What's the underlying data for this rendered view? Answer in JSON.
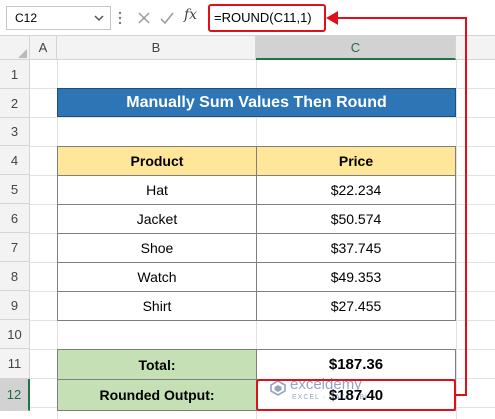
{
  "formula_bar": {
    "name_box": "C12",
    "fx_label": "fx",
    "formula": "=ROUND(C11,1)"
  },
  "columns": [
    "A",
    "B",
    "C"
  ],
  "rows": [
    "1",
    "2",
    "3",
    "4",
    "5",
    "6",
    "7",
    "8",
    "9",
    "10",
    "11",
    "12"
  ],
  "sheet": {
    "title": "Manually Sum Values Then Round",
    "table": {
      "headers": [
        "Product",
        "Price"
      ],
      "rows": [
        {
          "product": "Hat",
          "price": "$22.234"
        },
        {
          "product": "Jacket",
          "price": "$50.574"
        },
        {
          "product": "Shoe",
          "price": "$37.745"
        },
        {
          "product": "Watch",
          "price": "$49.353"
        },
        {
          "product": "Shirt",
          "price": "$27.455"
        }
      ]
    },
    "summary": {
      "total_label": "Total:",
      "total_value": "$187.36",
      "rounded_label": "Rounded Output:",
      "rounded_value": "$187.40"
    }
  },
  "watermark": {
    "name": "exceldemy",
    "tagline": "EXCEL · DATA · BI"
  },
  "colors": {
    "title_fill": "#2e75b6",
    "header_fill": "#ffe699",
    "summary_fill": "#c5e0b4",
    "callout": "#e0101a",
    "active_header": "#217346"
  }
}
